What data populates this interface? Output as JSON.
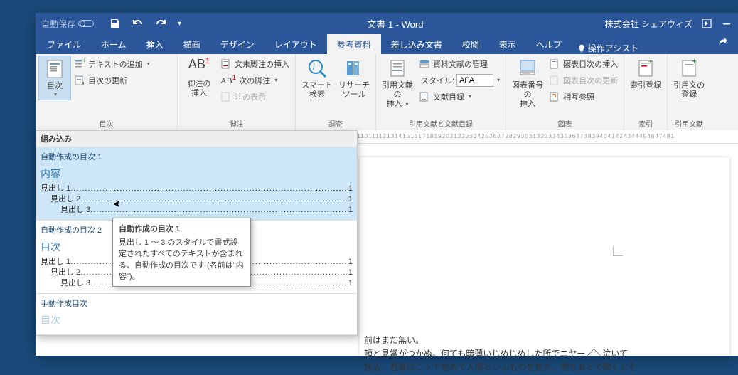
{
  "titlebar": {
    "autosave": "自動保存",
    "doc_title": "文書 1  -  Word",
    "company": "株式会社 シェアウィズ"
  },
  "tabs": {
    "file": "ファイル",
    "home": "ホーム",
    "insert": "挿入",
    "draw": "描画",
    "design": "デザイン",
    "layout": "レイアウト",
    "references": "参考資料",
    "mailings": "差し込み文書",
    "review": "校閲",
    "view": "表示",
    "help": "ヘルプ",
    "tell_me": "操作アシスト"
  },
  "ribbon": {
    "toc": {
      "label": "目次",
      "add_text": "テキストの追加",
      "update": "目次の更新",
      "group": "目次"
    },
    "footnote": {
      "insert_big_l1": "脚注の",
      "insert_big_l2": "挿入",
      "insert_end": "文末脚注の挿入",
      "next": "次の脚注",
      "show": "注の表示",
      "ab": "AB",
      "group": "脚注"
    },
    "smart": {
      "l1": "スマート",
      "l2": "検索",
      "group": "調査"
    },
    "research": {
      "l1": "リサーチ",
      "l2": "ツール"
    },
    "citation": {
      "l1": "引用文献の",
      "l2": "挿入",
      "manage": "資料文献の管理",
      "style_label": "スタイル:",
      "style_value": "APA",
      "biblio": "文献目録",
      "group": "引用文献と文献目録"
    },
    "caption": {
      "l1": "図表番号の",
      "l2": "挿入",
      "insert_fig": "図表目次の挿入",
      "update_fig": "図表目次の更新",
      "crossref": "相互参照",
      "group": "図表"
    },
    "index": {
      "l1": "索引登録",
      "group": "索引"
    },
    "toa": {
      "l1": "引用文の",
      "l2": "登録",
      "group": "引用文献"
    }
  },
  "toc_panel": {
    "builtin": "組み込み",
    "auto1": "自動作成の目次 1",
    "auto2": "自動作成の目次 2",
    "manual": "手動作成目次",
    "preview_title": "内容",
    "preview_title2": "目次",
    "h1": "見出し 1",
    "h2": "見出し 2",
    "h3": "見出し 3",
    "page": "1"
  },
  "tooltip": {
    "title": "自動作成の目次 1",
    "body": "見出し 1 ～ 3 のスタイルで書式設定されたすべてのテキストが含まれる、自動作成の目次です (名前は\"内容\")。"
  },
  "ruler_text": "110111121314151617181920212223242526272829303132333435363738394041424344454647481",
  "doc_text": {
    "l1": "前はまだ無い。",
    "l2": "頓と見當がつかぬ。何ても暗薄いじめじめした所でニヤー／＼泣いて",
    "l3": "居る。吾輩はこゝで始めて人間といふものを見た。然もあとで聞くとそ"
  }
}
